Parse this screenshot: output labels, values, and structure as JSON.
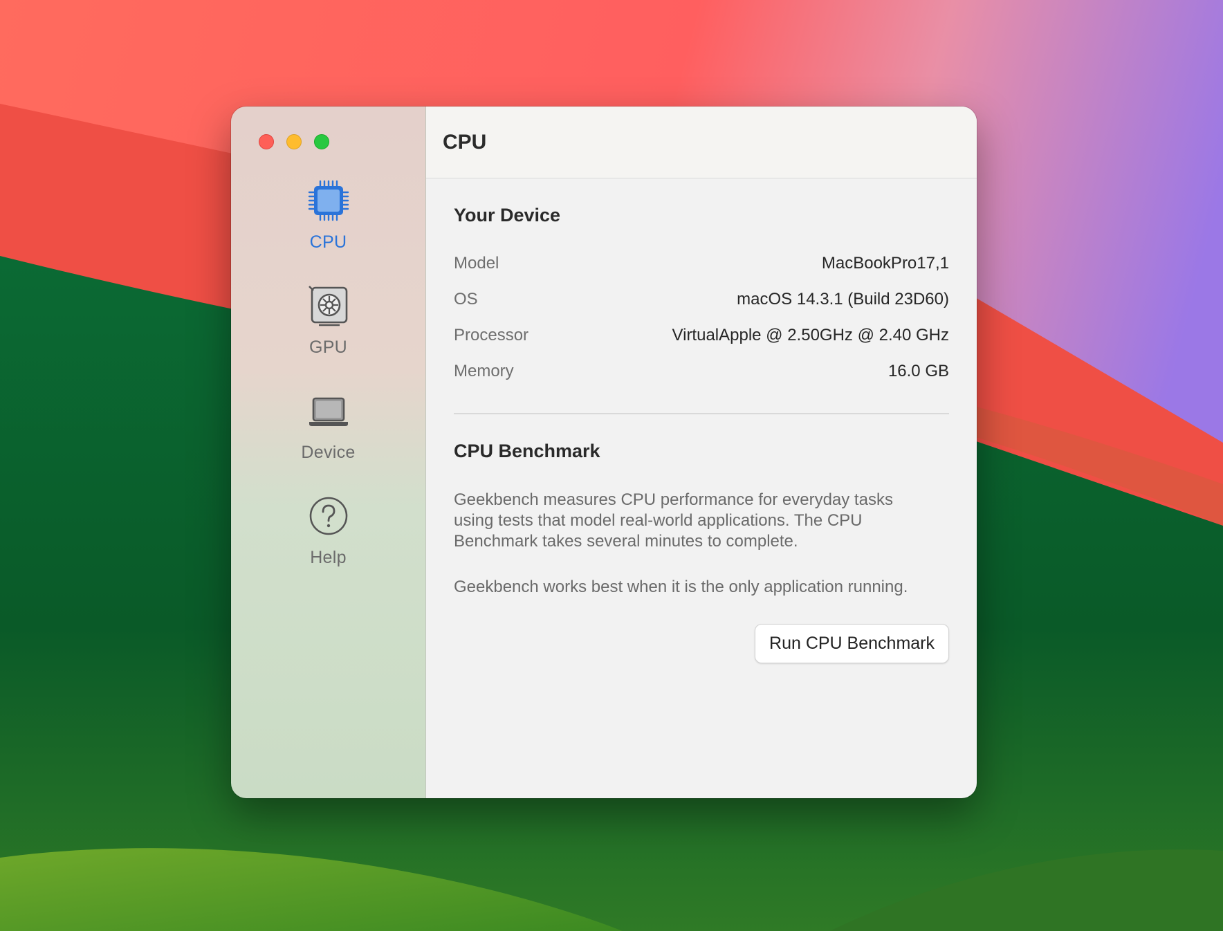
{
  "window": {
    "title": "CPU"
  },
  "sidebar": {
    "items": [
      {
        "label": "CPU",
        "icon": "cpu-chip-icon",
        "active": true
      },
      {
        "label": "GPU",
        "icon": "gpu-card-icon",
        "active": false
      },
      {
        "label": "Device",
        "icon": "laptop-icon",
        "active": false
      },
      {
        "label": "Help",
        "icon": "question-circle-icon",
        "active": false
      }
    ]
  },
  "device": {
    "title": "Your Device",
    "rows": [
      {
        "key": "Model",
        "value": "MacBookPro17,1"
      },
      {
        "key": "OS",
        "value": "macOS 14.3.1 (Build 23D60)"
      },
      {
        "key": "Processor",
        "value": "VirtualApple @ 2.50GHz @ 2.40 GHz"
      },
      {
        "key": "Memory",
        "value": "16.0 GB"
      }
    ]
  },
  "benchmark": {
    "title": "CPU Benchmark",
    "description": "Geekbench measures CPU performance for everyday tasks using tests that model real-world applications. The CPU Benchmark takes several minutes to complete.",
    "note": "Geekbench works best when it is the only application running.",
    "run_label": "Run CPU Benchmark"
  },
  "colors": {
    "accent": "#2a73d9",
    "close": "#fe5f57",
    "minimize": "#febc2e",
    "maximize": "#28c840"
  }
}
